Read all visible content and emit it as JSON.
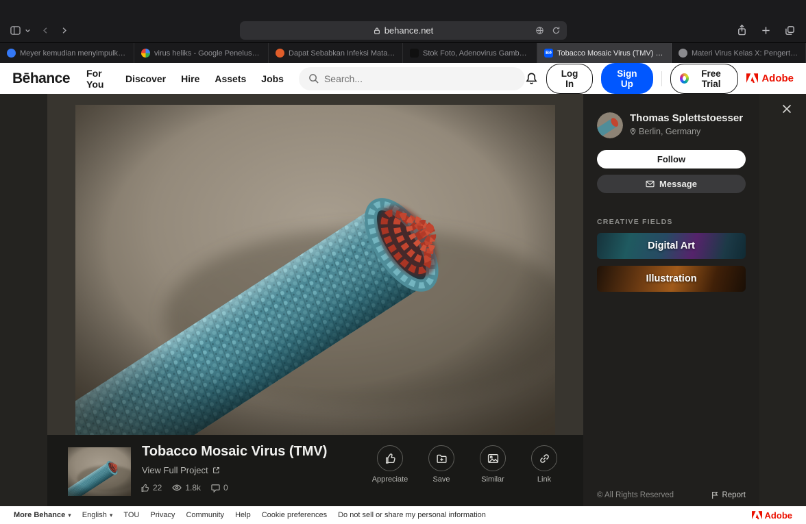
{
  "colors": {
    "behance_blue": "#0057ff",
    "adobe_red": "#eb1000",
    "virus_teal": "#4e8f9c",
    "virus_red": "#c2452f"
  },
  "browser": {
    "url": "behance.net",
    "tabs": [
      {
        "label": "Meyer kemudian menyimpulkan...",
        "icon": "site-favicon-blue"
      },
      {
        "label": "virus heliks - Google Penelusuran",
        "icon": "google-favicon"
      },
      {
        "label": "Dapat Sebabkan Infeksi Mata, Ini...",
        "icon": "site-favicon-red"
      },
      {
        "label": "Stok Foto, Adenovirus Gambar B...",
        "icon": "istock-favicon"
      },
      {
        "label": "Tobacco Mosaic Virus (TMV) | Be...",
        "icon": "behance-favicon",
        "glyph": "Bē"
      },
      {
        "label": "Materi Virus Kelas X: Pengertian,...",
        "icon": "site-favicon-gray"
      }
    ]
  },
  "header": {
    "logo": "Bēhance",
    "nav": [
      {
        "label": "For You"
      },
      {
        "label": "Discover"
      },
      {
        "label": "Hire"
      },
      {
        "label": "Assets"
      },
      {
        "label": "Jobs"
      }
    ],
    "search_placeholder": "Search...",
    "log_in": "Log In",
    "sign_up": "Sign Up",
    "free_trial": "Free Trial",
    "adobe": "Adobe"
  },
  "profile": {
    "name": "Thomas Splettstoesser",
    "location": "Berlin, Germany",
    "follow": "Follow",
    "message": "Message"
  },
  "creative_fields": {
    "heading": "CREATIVE FIELDS",
    "items": [
      {
        "label": "Digital Art"
      },
      {
        "label": "Illustration"
      }
    ]
  },
  "rights": {
    "text": "© All Rights Reserved",
    "report": "Report"
  },
  "project": {
    "title": "Tobacco Mosaic Virus (TMV)",
    "view_full": "View Full Project",
    "stats": {
      "appreciations": "22",
      "views": "1.8k",
      "comments": "0"
    },
    "actions": [
      {
        "label": "Appreciate",
        "icon": "thumbs-up-icon"
      },
      {
        "label": "Save",
        "icon": "folder-plus-icon"
      },
      {
        "label": "Similar",
        "icon": "image-icon"
      },
      {
        "label": "Link",
        "icon": "chain-link-icon"
      }
    ]
  },
  "footer": {
    "more_behance": "More Behance",
    "language": "English",
    "links": [
      {
        "label": "TOU"
      },
      {
        "label": "Privacy"
      },
      {
        "label": "Community"
      },
      {
        "label": "Help"
      },
      {
        "label": "Cookie preferences"
      },
      {
        "label": "Do not sell or share my personal information"
      }
    ],
    "adobe": "Adobe"
  }
}
